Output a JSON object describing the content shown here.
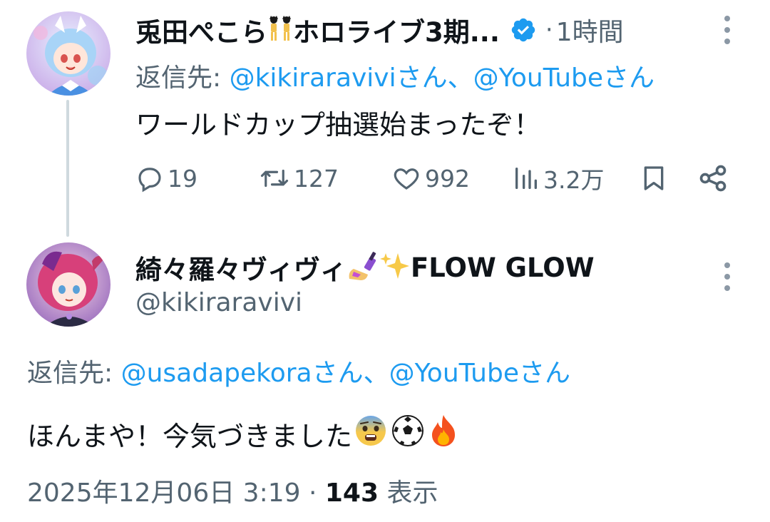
{
  "tweet1": {
    "author_name": "兎田ぺこら",
    "author_name_suffix": "ホロライブ3期...",
    "verified": true,
    "separator": "·",
    "time_ago": "1時間",
    "reply_prefix": "返信先: ",
    "reply_mention_1": "@kikiraravivi",
    "reply_suffix_1": "さん、",
    "reply_mention_2": "@YouTube",
    "reply_suffix_2": "さん",
    "text": "ワールドカップ抽選始まったぞ！",
    "actions": {
      "replies": "19",
      "retweets": "127",
      "likes": "992",
      "views": "3.2万"
    }
  },
  "tweet2": {
    "author_name": "綺々羅々ヴィヴィ",
    "author_name_suffix": "FLOW GLOW",
    "handle": "@kikiraravivi",
    "reply_prefix": "返信先: ",
    "reply_mention_1": "@usadapekora",
    "reply_suffix_1": "さん、",
    "reply_mention_2": "@YouTube",
    "reply_suffix_2": "さん",
    "text": "ほんまや！今気づきました",
    "date_time": "2025年12月06日 3:19",
    "separator": " · ",
    "view_count": "143",
    "view_label": " 表示"
  },
  "colors": {
    "accent": "#1d9bf0",
    "secondary_text": "#536471",
    "primary_text": "#0f1419",
    "thread_line": "#cfd9de"
  },
  "icons": [
    "reply-icon",
    "retweet-icon",
    "like-icon",
    "views-icon",
    "bookmark-icon",
    "share-icon",
    "more-icon",
    "verified-icon",
    "dancers-emoji",
    "nail-polish-emoji",
    "sparkles-emoji",
    "fearful-face-emoji",
    "soccer-ball-emoji",
    "fire-emoji"
  ]
}
